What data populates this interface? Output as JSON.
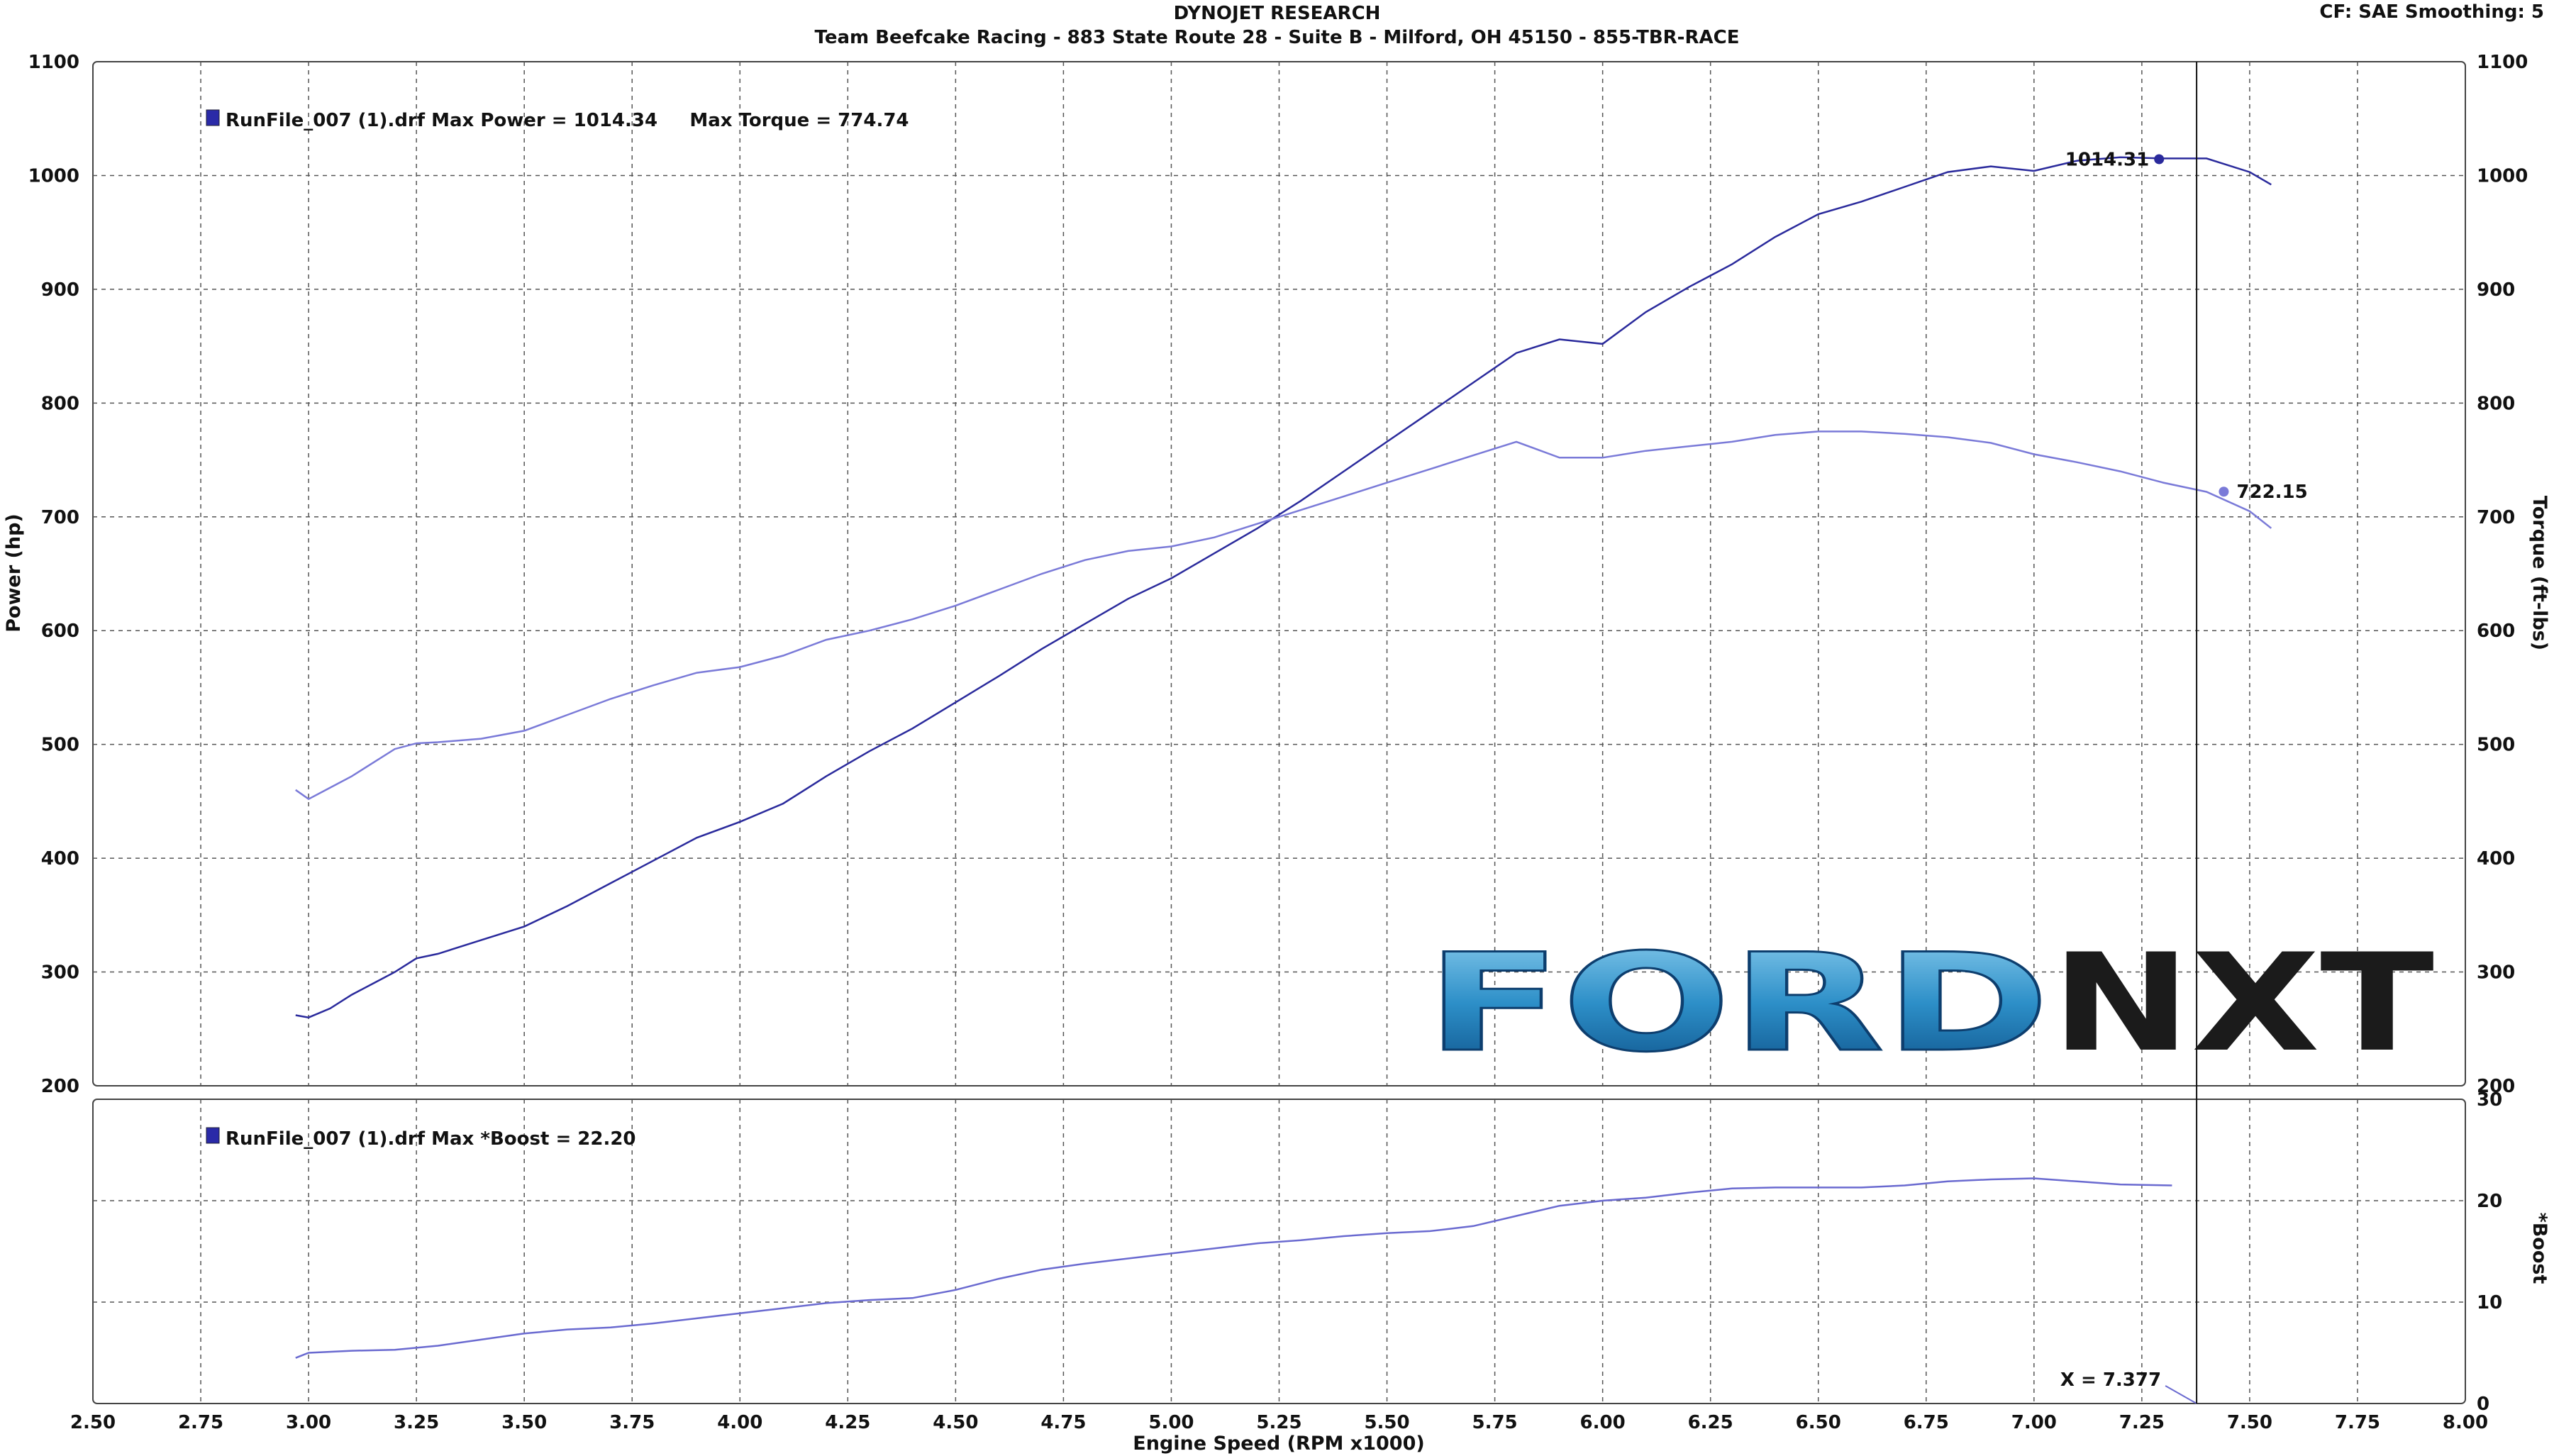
{
  "header": {
    "title": "DYNOJET RESEARCH",
    "subtitle": "Team Beefcake Racing - 883 State Route 28 - Suite B - Milford, OH 45150 - 855-TBR-RACE",
    "cf_info": "CF: SAE  Smoothing: 5"
  },
  "watermark": {
    "text_light": "FORD",
    "text_dark": "NXT"
  },
  "colors": {
    "power": "#2a2a9c",
    "torque": "#7a7ad8",
    "boost": "#6a6ad0",
    "grid": "#555555",
    "cursor": "#111111"
  },
  "cursor": {
    "x": 7.377,
    "label": "X = 7.377"
  },
  "chart_data": [
    {
      "type": "line",
      "panel": "power-torque",
      "legend": "RunFile_007 (1).drf Max Power = 1014.34     Max Torque = 774.74",
      "xlabel": "Engine Speed (RPM x1000)",
      "ylabel": "Power (hp)",
      "y2label": "Torque (ft-lbs)",
      "xlim": [
        2.5,
        8.0
      ],
      "ylim": [
        200,
        1100
      ],
      "y2lim": [
        200,
        1100
      ],
      "x_ticks": [
        "2.50",
        "2.75",
        "3.00",
        "3.25",
        "3.50",
        "3.75",
        "4.00",
        "4.25",
        "4.50",
        "4.75",
        "5.00",
        "5.25",
        "5.50",
        "5.75",
        "6.00",
        "6.25",
        "6.50",
        "6.75",
        "7.00",
        "7.25",
        "7.50",
        "7.75",
        "8.00"
      ],
      "y_ticks": [
        "200",
        "300",
        "400",
        "500",
        "600",
        "700",
        "800",
        "900",
        "1000",
        "1100"
      ],
      "grid": true,
      "series": [
        {
          "name": "Power",
          "axis": "left",
          "x": [
            2.97,
            3.0,
            3.05,
            3.1,
            3.15,
            3.2,
            3.25,
            3.3,
            3.4,
            3.5,
            3.6,
            3.7,
            3.8,
            3.9,
            4.0,
            4.1,
            4.2,
            4.3,
            4.4,
            4.5,
            4.6,
            4.7,
            4.8,
            4.9,
            5.0,
            5.1,
            5.2,
            5.3,
            5.4,
            5.5,
            5.6,
            5.7,
            5.8,
            5.9,
            6.0,
            6.1,
            6.2,
            6.3,
            6.4,
            6.5,
            6.6,
            6.7,
            6.8,
            6.9,
            7.0,
            7.1,
            7.2,
            7.3,
            7.4,
            7.5,
            7.55
          ],
          "values": [
            262,
            260,
            268,
            280,
            290,
            300,
            312,
            316,
            328,
            340,
            358,
            378,
            398,
            418,
            432,
            448,
            472,
            494,
            514,
            537,
            560,
            584,
            606,
            628,
            646,
            668,
            690,
            714,
            740,
            766,
            792,
            818,
            844,
            856,
            852,
            880,
            902,
            922,
            946,
            966,
            977,
            990,
            1003,
            1008,
            1004,
            1013,
            1016,
            1015,
            1015,
            1003,
            992
          ]
        },
        {
          "name": "Torque",
          "axis": "right",
          "x": [
            2.97,
            3.0,
            3.05,
            3.1,
            3.15,
            3.2,
            3.25,
            3.3,
            3.4,
            3.5,
            3.6,
            3.7,
            3.8,
            3.9,
            4.0,
            4.1,
            4.2,
            4.3,
            4.4,
            4.5,
            4.6,
            4.7,
            4.8,
            4.9,
            5.0,
            5.1,
            5.2,
            5.3,
            5.4,
            5.5,
            5.6,
            5.7,
            5.8,
            5.9,
            6.0,
            6.1,
            6.2,
            6.3,
            6.4,
            6.5,
            6.6,
            6.7,
            6.8,
            6.9,
            7.0,
            7.1,
            7.2,
            7.3,
            7.4,
            7.5,
            7.55
          ],
          "values": [
            460,
            452,
            462,
            472,
            484,
            496,
            501,
            502,
            505,
            512,
            526,
            540,
            552,
            563,
            568,
            578,
            592,
            600,
            610,
            622,
            636,
            650,
            662,
            670,
            674,
            682,
            694,
            706,
            718,
            730,
            742,
            754,
            766,
            752,
            752,
            758,
            762,
            766,
            772,
            775,
            775,
            773,
            770,
            765,
            755,
            748,
            740,
            730,
            722,
            705,
            690
          ]
        }
      ],
      "annotations": [
        {
          "label": "1014.31",
          "x": 7.29,
          "y": 1014.31,
          "series": "Power"
        },
        {
          "label": "722.15",
          "x": 7.44,
          "y": 722.15,
          "series": "Torque"
        }
      ]
    },
    {
      "type": "line",
      "panel": "boost",
      "legend": "RunFile_007 (1).drf Max *Boost = 22.20",
      "y2label": "*Boost",
      "xlim": [
        2.5,
        8.0
      ],
      "ylim": [
        0,
        30
      ],
      "y_ticks": [
        "0",
        "10",
        "20",
        "30"
      ],
      "grid": true,
      "series": [
        {
          "name": "*Boost",
          "axis": "right",
          "x": [
            2.97,
            3.0,
            3.1,
            3.2,
            3.3,
            3.4,
            3.5,
            3.6,
            3.7,
            3.8,
            3.9,
            4.0,
            4.1,
            4.2,
            4.3,
            4.4,
            4.5,
            4.6,
            4.7,
            4.8,
            4.9,
            5.0,
            5.1,
            5.2,
            5.3,
            5.4,
            5.5,
            5.6,
            5.7,
            5.8,
            5.9,
            6.0,
            6.1,
            6.2,
            6.3,
            6.4,
            6.5,
            6.6,
            6.7,
            6.8,
            6.9,
            7.0,
            7.1,
            7.2,
            7.32
          ],
          "values": [
            4.5,
            5,
            5.2,
            5.3,
            5.7,
            6.3,
            6.9,
            7.3,
            7.5,
            7.9,
            8.4,
            8.9,
            9.4,
            9.9,
            10.2,
            10.4,
            11.2,
            12.3,
            13.2,
            13.8,
            14.3,
            14.8,
            15.3,
            15.8,
            16.1,
            16.5,
            16.8,
            17,
            17.5,
            18.5,
            19.5,
            20.0,
            20.3,
            20.8,
            21.2,
            21.3,
            21.3,
            21.3,
            21.5,
            21.9,
            22.1,
            22.2,
            21.9,
            21.6,
            21.5
          ]
        }
      ]
    }
  ]
}
